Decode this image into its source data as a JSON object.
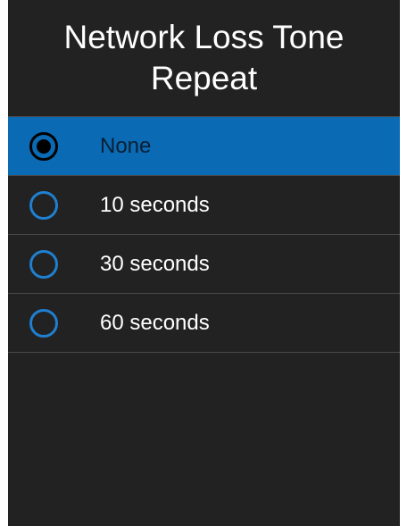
{
  "title": {
    "line1": "Network Loss Tone",
    "line2": "Repeat"
  },
  "options": [
    {
      "label": "None",
      "selected": true
    },
    {
      "label": "10 seconds",
      "selected": false
    },
    {
      "label": "30 seconds",
      "selected": false
    },
    {
      "label": "60 seconds",
      "selected": false
    }
  ],
  "colors": {
    "background": "#222222",
    "selected_row": "#0a6ab3",
    "radio_ring": "#1f7fd0",
    "text": "#ffffff"
  }
}
